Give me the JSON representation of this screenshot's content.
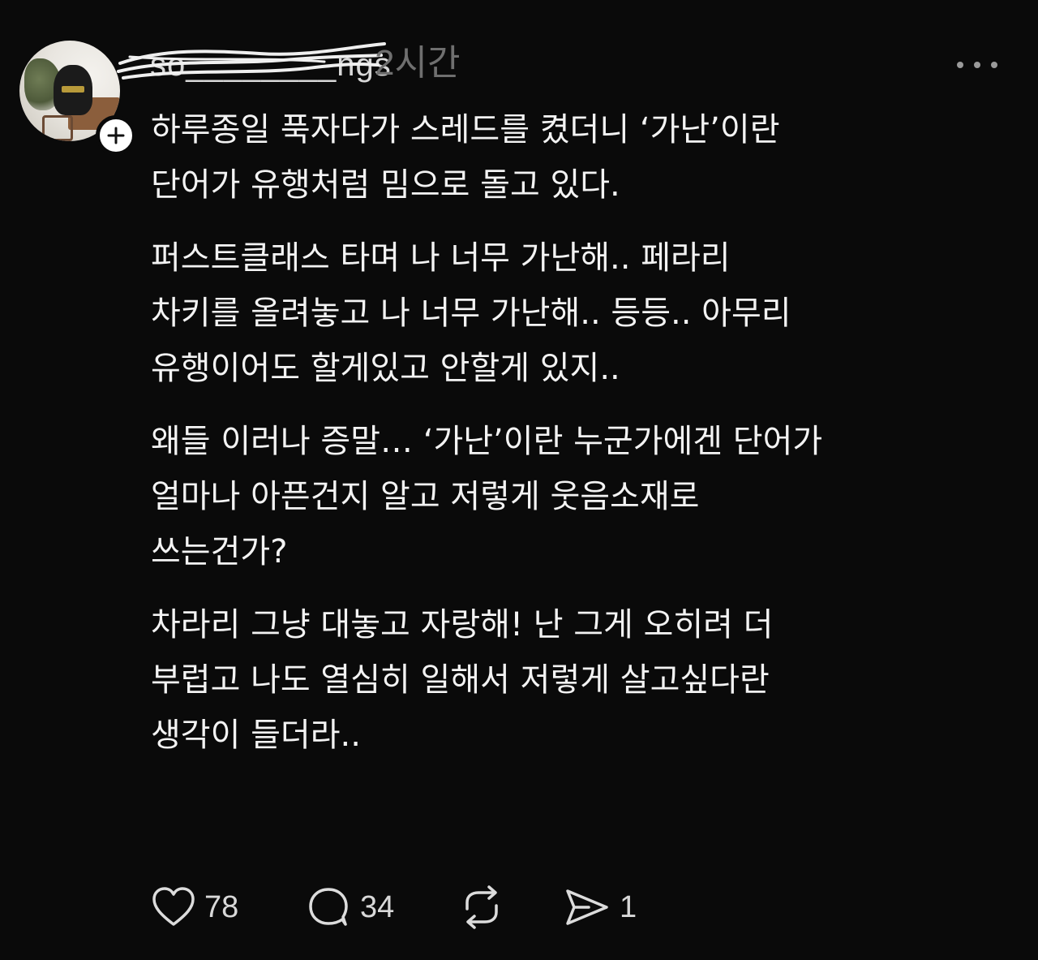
{
  "post": {
    "username": "so________ngs",
    "timestamp": "2시간",
    "paragraphs": [
      [
        "하루종일 푹자다가 스레드를 켰더니 ‘가난’이란",
        "단어가 유행처럼 밈으로 돌고 있다."
      ],
      [
        "퍼스트클래스 타며 나 너무 가난해.. 페라리",
        "차키를 올려놓고 나 너무 가난해.. 등등.. 아무리",
        "유행이어도 할게있고 안할게 있지.."
      ],
      [
        "왜들 이러나 증말… ‘가난’이란 누군가에겐 단어가",
        "얼마나 아픈건지 알고 저렇게 웃음소재로",
        "쓰는건가?"
      ],
      [
        "차라리 그냥 대놓고 자랑해! 난 그게 오히려 더",
        "부럽고 나도 열심히 일해서 저렇게 살고싶다란",
        "생각이 들더라.."
      ]
    ]
  },
  "actions": {
    "likes": "78",
    "comments": "34",
    "shares": "1"
  },
  "icons": {
    "avatar": "profile-photo",
    "follow": "plus-icon",
    "more": "more-horizontal-icon",
    "like": "heart-icon",
    "comment": "comment-bubble-icon",
    "repost": "repost-icon",
    "share": "send-icon"
  },
  "colors": {
    "background": "#0a0a0a",
    "text": "#f3f3f3",
    "muted": "#6f6f6f"
  }
}
